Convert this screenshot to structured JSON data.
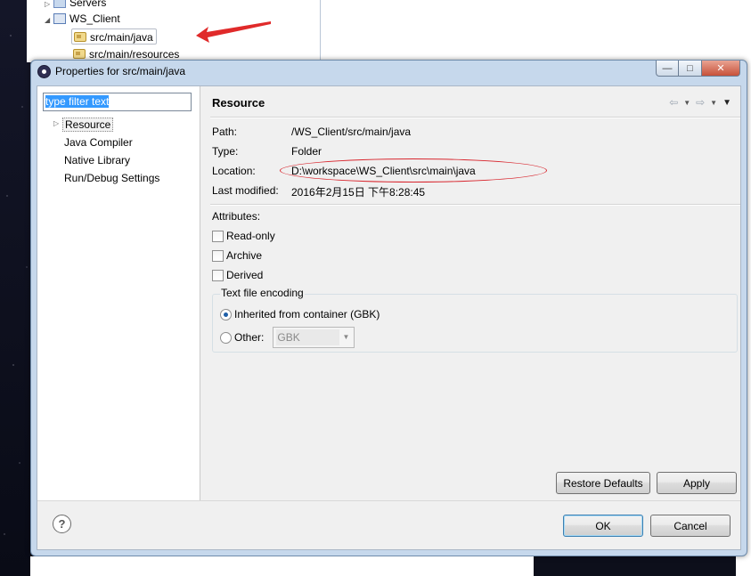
{
  "explorer": {
    "items": [
      {
        "label": "Servers"
      },
      {
        "label": "WS_Client"
      },
      {
        "label": "src/main/java"
      },
      {
        "label": "src/main/resources"
      }
    ]
  },
  "dialog": {
    "title": "Properties for src/main/java",
    "window_buttons": {
      "minimize": "—",
      "maximize": "□",
      "close": "✕"
    },
    "filter_placeholder": "type filter text",
    "tree": [
      {
        "label": "Resource"
      },
      {
        "label": "Java Compiler"
      },
      {
        "label": "Native Library"
      },
      {
        "label": "Run/Debug Settings"
      }
    ],
    "section_title": "Resource",
    "nav": {
      "back": "⇦",
      "forward": "⇨",
      "dropdown": "▼",
      "menu": "▼"
    },
    "fields": [
      {
        "label": "Path:",
        "value": "/WS_Client/src/main/java"
      },
      {
        "label": "Type:",
        "value": "Folder"
      },
      {
        "label": "Location:",
        "value": "D:\\workspace\\WS_Client\\src\\main\\java"
      },
      {
        "label": "Last modified:",
        "value": "2016年2月15日 下午8:28:45"
      }
    ],
    "attributes_label": "Attributes:",
    "attributes": [
      {
        "label": "Read-only",
        "checked": false
      },
      {
        "label": "Archive",
        "checked": false
      },
      {
        "label": "Derived",
        "checked": false
      }
    ],
    "encoding": {
      "group_title": "Text file encoding",
      "inherited_label": "Inherited from container (GBK)",
      "other_label": "Other:",
      "other_value": "GBK",
      "selected": "inherited"
    },
    "buttons": {
      "restore_defaults": "Restore Defaults",
      "apply": "Apply",
      "ok": "OK",
      "cancel": "Cancel",
      "help": "?"
    }
  },
  "colors": {
    "annotation_red": "#d8262e",
    "dialog_frame": "#c6d8ec",
    "selection_blue": "#3399ff"
  }
}
